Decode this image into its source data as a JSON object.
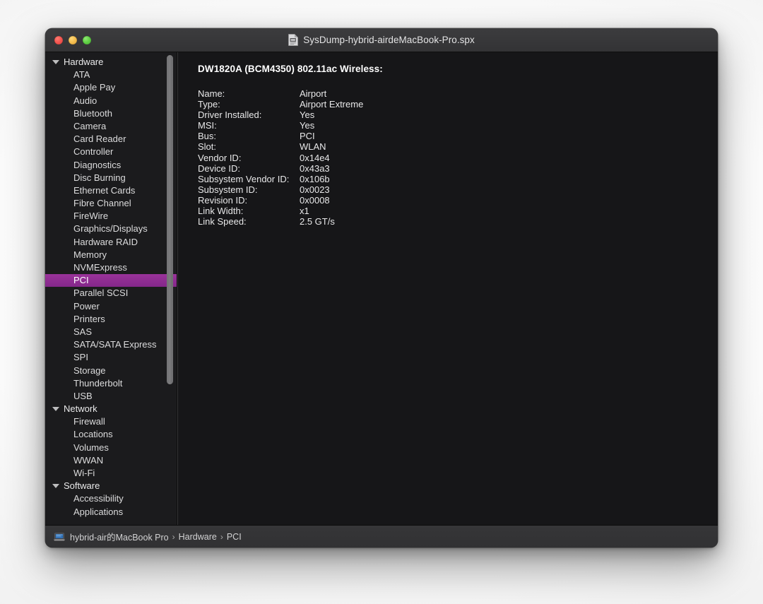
{
  "window": {
    "title": "SysDump-hybrid-airdeMacBook-Pro.spx",
    "doc_icon": "spx-document-icon",
    "traffic_lights": {
      "close": "close-button",
      "minimize": "minimize-button",
      "maximize": "maximize-button"
    }
  },
  "sidebar": {
    "groups": [
      {
        "label": "Hardware",
        "expanded": true,
        "items": [
          "ATA",
          "Apple Pay",
          "Audio",
          "Bluetooth",
          "Camera",
          "Card Reader",
          "Controller",
          "Diagnostics",
          "Disc Burning",
          "Ethernet Cards",
          "Fibre Channel",
          "FireWire",
          "Graphics/Displays",
          "Hardware RAID",
          "Memory",
          "NVMExpress",
          "PCI",
          "Parallel SCSI",
          "Power",
          "Printers",
          "SAS",
          "SATA/SATA Express",
          "SPI",
          "Storage",
          "Thunderbolt",
          "USB"
        ]
      },
      {
        "label": "Network",
        "expanded": true,
        "items": [
          "Firewall",
          "Locations",
          "Volumes",
          "WWAN",
          "Wi-Fi"
        ]
      },
      {
        "label": "Software",
        "expanded": true,
        "items": [
          "Accessibility",
          "Applications"
        ]
      }
    ],
    "selected": "PCI",
    "selection_color": "#8b2a8b"
  },
  "content": {
    "heading": "DW1820A (BCM4350) 802.11ac Wireless:",
    "details": [
      {
        "label": "Name:",
        "value": "Airport"
      },
      {
        "label": "Type:",
        "value": "Airport Extreme"
      },
      {
        "label": "Driver Installed:",
        "value": "Yes"
      },
      {
        "label": "MSI:",
        "value": "Yes"
      },
      {
        "label": "Bus:",
        "value": "PCI"
      },
      {
        "label": "Slot:",
        "value": "WLAN"
      },
      {
        "label": "Vendor ID:",
        "value": "0x14e4"
      },
      {
        "label": "Device ID:",
        "value": "0x43a3"
      },
      {
        "label": "Subsystem Vendor ID:",
        "value": "0x106b"
      },
      {
        "label": "Subsystem ID:",
        "value": "0x0023"
      },
      {
        "label": "Revision ID:",
        "value": "0x0008"
      },
      {
        "label": "Link Width:",
        "value": "x1"
      },
      {
        "label": "Link Speed:",
        "value": "2.5 GT/s"
      }
    ]
  },
  "statusbar": {
    "icon": "laptop-icon",
    "breadcrumb": [
      "hybrid-air的MacBook Pro",
      "Hardware",
      "PCI"
    ],
    "separator": "›"
  }
}
